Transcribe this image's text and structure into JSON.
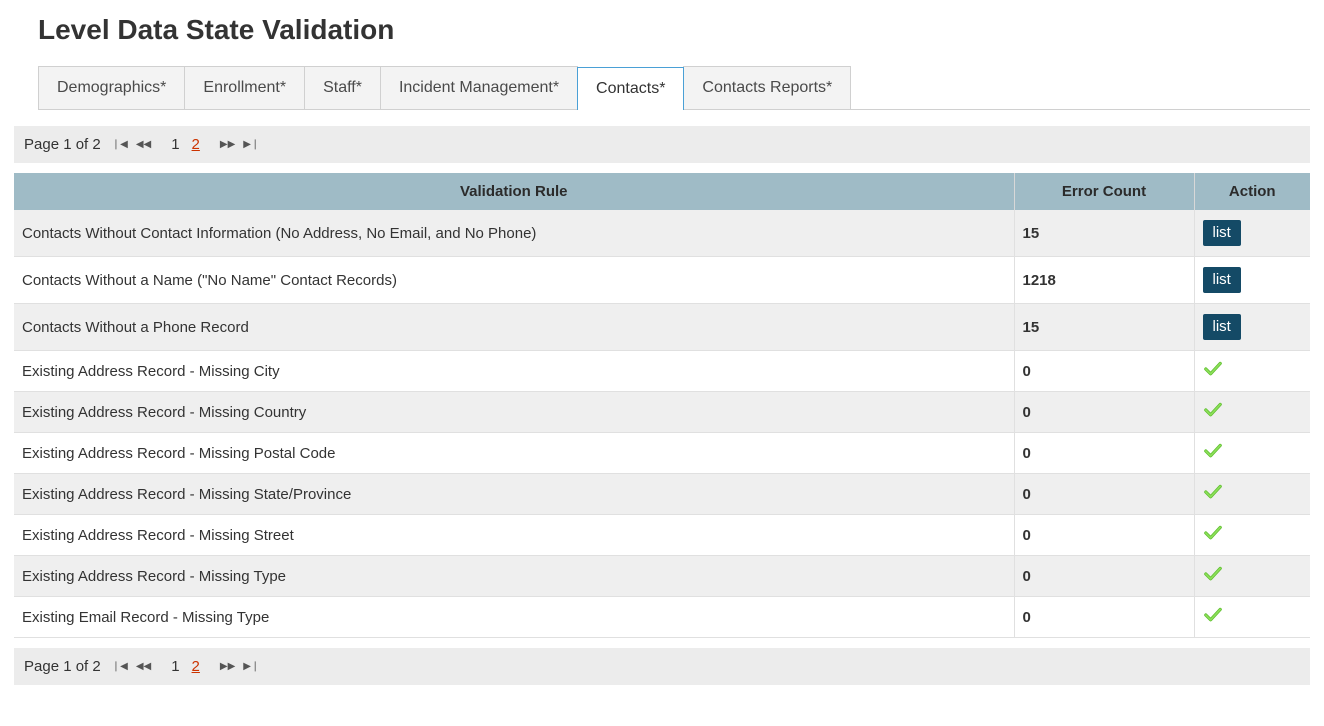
{
  "header": {
    "title": "Level Data State Validation"
  },
  "tabs": {
    "items": [
      {
        "label": "Demographics*",
        "active": false
      },
      {
        "label": "Enrollment*",
        "active": false
      },
      {
        "label": "Staff*",
        "active": false
      },
      {
        "label": "Incident Management*",
        "active": false
      },
      {
        "label": "Contacts*",
        "active": true
      },
      {
        "label": "Contacts Reports*",
        "active": false
      }
    ]
  },
  "pager": {
    "label": "Page 1 of 2",
    "pages": {
      "current": "1",
      "other": "2"
    }
  },
  "table": {
    "headers": {
      "rule": "Validation Rule",
      "count": "Error Count",
      "action": "Action"
    },
    "list_button_label": "list",
    "rows": [
      {
        "rule": "Contacts Without Contact Information (No Address, No Email, and No Phone)",
        "count": "15",
        "action": "list"
      },
      {
        "rule": "Contacts Without a Name (\"No Name\" Contact Records)",
        "count": "1218",
        "action": "list"
      },
      {
        "rule": "Contacts Without a Phone Record",
        "count": "15",
        "action": "list"
      },
      {
        "rule": "Existing Address Record - Missing City",
        "count": "0",
        "action": "check"
      },
      {
        "rule": "Existing Address Record - Missing Country",
        "count": "0",
        "action": "check"
      },
      {
        "rule": "Existing Address Record - Missing Postal Code",
        "count": "0",
        "action": "check"
      },
      {
        "rule": "Existing Address Record - Missing State/Province",
        "count": "0",
        "action": "check"
      },
      {
        "rule": "Existing Address Record - Missing Street",
        "count": "0",
        "action": "check"
      },
      {
        "rule": "Existing Address Record - Missing Type",
        "count": "0",
        "action": "check"
      },
      {
        "rule": "Existing Email Record - Missing Type",
        "count": "0",
        "action": "check"
      }
    ]
  }
}
